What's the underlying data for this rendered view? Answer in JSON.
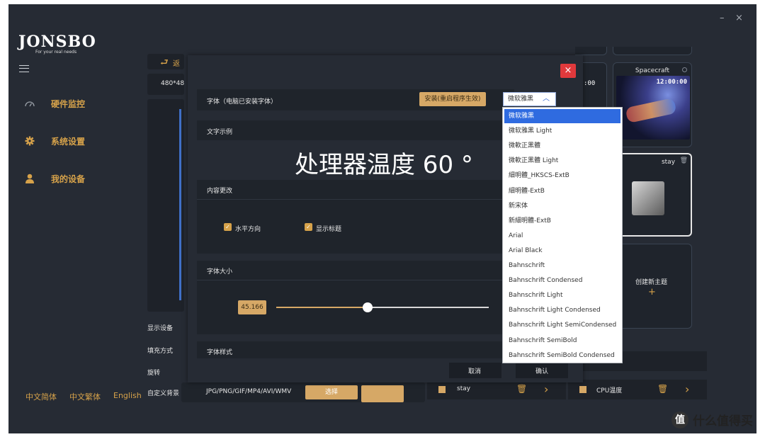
{
  "brand": {
    "name": "JONSBO",
    "tagline": "For your real needs"
  },
  "window_controls": {
    "minimize": "–",
    "close": "×"
  },
  "sidebar": {
    "items": [
      {
        "label": "硬件监控",
        "icon": "gauge-icon"
      },
      {
        "label": "系统设置",
        "icon": "gear-icon"
      },
      {
        "label": "我的设备",
        "icon": "user-icon"
      }
    ],
    "languages": [
      "中文简体",
      "中文繁体",
      "English"
    ]
  },
  "background": {
    "back_label": "返",
    "resolution": "480*48",
    "row_labels": [
      "显示设备",
      "填充方式",
      "旋转",
      "自定义背景"
    ],
    "bg_formats": "JPG/PNG/GIF/MP4/AVI/WMV",
    "select_button": "选择",
    "themes": [
      {
        "title": "Spacecraft",
        "time": "12:00:00"
      },
      {
        "title": "stay"
      },
      {
        "title": "创建新主题",
        "plus": "+"
      }
    ],
    "bottom_items": [
      {
        "label": "stay"
      },
      {
        "label": "CPU温度"
      }
    ]
  },
  "dialog": {
    "close": "×",
    "font_section": {
      "label": "字体（电脑已安装字体）",
      "install_button": "安装(重启程序生效)",
      "selected_font": "微软雅黑"
    },
    "sample_section": {
      "label": "文字示例",
      "preview": "处理器温度 60 °"
    },
    "content_section": {
      "label": "内容更改",
      "checkbox_horizontal": "水平方向",
      "checkbox_title": "显示标题"
    },
    "size_section": {
      "label": "字体大小",
      "value": "45.166",
      "slider_fraction": 0.43
    },
    "style_section": {
      "label": "字体样式"
    },
    "cancel": "取消",
    "confirm": "确认"
  },
  "font_options": [
    "微软雅黑",
    "微软雅黑 Light",
    "微軟正黑體",
    "微軟正黑體 Light",
    "細明體_HKSCS-ExtB",
    "細明體-ExtB",
    "新宋体",
    "新細明體-ExtB",
    "Arial",
    "Arial Black",
    "Bahnschrift",
    "Bahnschrift Condensed",
    "Bahnschrift Light",
    "Bahnschrift Light Condensed",
    "Bahnschrift Light SemiCondensed",
    "Bahnschrift SemiBold",
    "Bahnschrift SemiBold Condensed"
  ],
  "watermark": {
    "icon": "值",
    "text": "什么值得买"
  },
  "colors": {
    "accent": "#d6a24a",
    "button_gold": "#d6a866",
    "close_red": "#e0393c",
    "selection_blue": "#2f6be0",
    "panel": "#262b34"
  }
}
